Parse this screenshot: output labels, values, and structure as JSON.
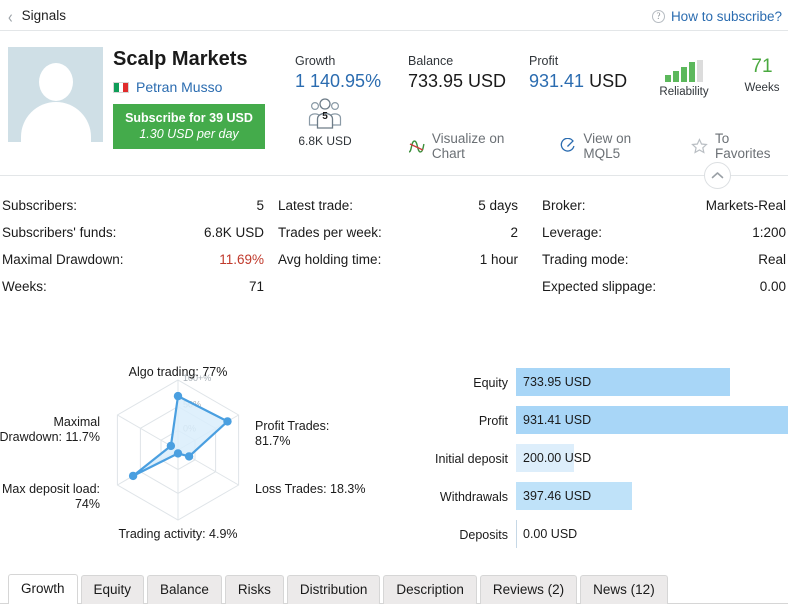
{
  "topbar": {
    "back_label": "Signals",
    "back_icon": "chevron-left-icon",
    "help_icon": "question-circle-icon",
    "help_label": "How to subscribe?"
  },
  "profile": {
    "avatar_icon": "user-avatar-placeholder",
    "signal_name": "Scalp Markets",
    "author_name": "Petran Musso",
    "flag": "italy-flag-icon",
    "subscribe_primary": "Subscribe for 39 USD",
    "subscribe_secondary": "1.30 USD per day",
    "subscribe_color": "#44ab4b"
  },
  "kpis": {
    "growth": {
      "label": "Growth",
      "value": "1 140.95%",
      "color": "#2b6cb0"
    },
    "balance": {
      "label": "Balance",
      "value": "733.95 USD"
    },
    "profit": {
      "label": "Profit",
      "value": "931.41 USD",
      "accent": "931.41"
    },
    "subscribers_badge": {
      "count": "5",
      "funds": "6.8K USD",
      "icon": "subscribers-group-icon"
    },
    "reliability": {
      "label": "Reliability",
      "filled": 4,
      "total": 5,
      "color": "#5cb85c"
    },
    "weeks": {
      "value": "71",
      "label": "Weeks",
      "color": "#4aa93f"
    }
  },
  "actions": [
    {
      "icon": "chart-line-icon",
      "label": "Visualize on Chart"
    },
    {
      "icon": "external-link-icon",
      "label": "View on MQL5"
    },
    {
      "icon": "star-icon",
      "label": "To Favorites"
    }
  ],
  "collapse": {
    "icon": "chevron-up-icon"
  },
  "stats": {
    "col1": [
      {
        "key": "Subscribers:",
        "value": "5"
      },
      {
        "key": "Subscribers' funds:",
        "value": "6.8K USD"
      },
      {
        "key": "Maximal Drawdown:",
        "value": "11.69%",
        "warn": true
      },
      {
        "key": "Weeks:",
        "value": "71"
      }
    ],
    "col2": [
      {
        "key": "Latest trade:",
        "value": "5 days"
      },
      {
        "key": "Trades per week:",
        "value": "2"
      },
      {
        "key": "Avg holding time:",
        "value": "1 hour"
      }
    ],
    "col3": [
      {
        "key": "Broker:",
        "value": "Markets-Real"
      },
      {
        "key": "Leverage:",
        "value": "1:200"
      },
      {
        "key": "Trading mode:",
        "value": "Real"
      },
      {
        "key": "Expected slippage:",
        "value": "0.00"
      }
    ]
  },
  "chart_data": [
    {
      "type": "radar",
      "title": "",
      "categories": [
        "Algo trading",
        "Profit Trades",
        "Loss Trades",
        "Trading activity",
        "Max deposit load",
        "Maximal Drawdown"
      ],
      "labels": [
        "Algo trading: 77%",
        "Profit Trades:\n81.7%",
        "Loss Trades: 18.3%",
        "Trading activity: 4.9%",
        "Max deposit load:\n74%",
        "Maximal\nDrawdown: 11.7%"
      ],
      "values": [
        77,
        81.7,
        18.3,
        4.9,
        74,
        11.7
      ],
      "ring_labels": [
        "0%",
        "50%",
        "100+%"
      ],
      "rlim": [
        0,
        100
      ],
      "grid": true,
      "line_color": "#4a9fe0",
      "fill_color": "#d9edfb"
    },
    {
      "type": "bar",
      "orientation": "horizontal",
      "title": "",
      "categories": [
        "Equity",
        "Profit",
        "Initial deposit",
        "Withdrawals",
        "Deposits"
      ],
      "values": [
        733.95,
        931.41,
        200.0,
        397.46,
        0.0
      ],
      "value_labels": [
        "733.95 USD",
        "931.41 USD",
        "200.00 USD",
        "397.46 USD",
        "0.00 USD"
      ],
      "unit": "USD",
      "xlim": [
        0,
        931.41
      ],
      "grid": false,
      "bar_colors": [
        "#a8d6f7",
        "#a8d6f7",
        "#ddeefb",
        "#bfe2f9",
        "transparent"
      ]
    }
  ],
  "tabs": [
    {
      "label": "Growth",
      "active": true
    },
    {
      "label": "Equity",
      "active": false
    },
    {
      "label": "Balance",
      "active": false
    },
    {
      "label": "Risks",
      "active": false
    },
    {
      "label": "Distribution",
      "active": false
    },
    {
      "label": "Description",
      "active": false
    },
    {
      "label": "Reviews (2)",
      "active": false
    },
    {
      "label": "News (12)",
      "active": false
    }
  ]
}
